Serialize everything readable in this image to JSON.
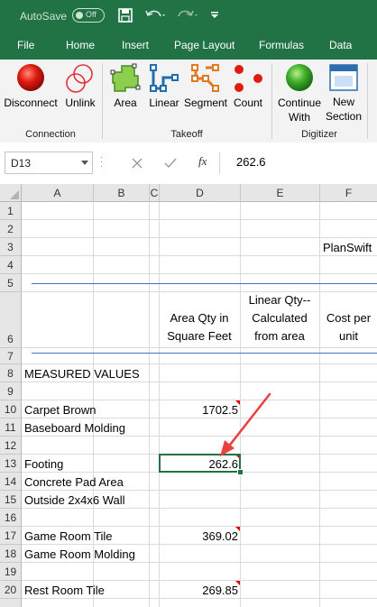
{
  "titlebar": {
    "autosave_label": "AutoSave",
    "autosave_state": "Off"
  },
  "tabs": [
    "File",
    "Home",
    "Insert",
    "Page Layout",
    "Formulas",
    "Data"
  ],
  "ribbon": {
    "connection": {
      "group": "Connection",
      "disconnect": "Disconnect",
      "unlink": "Unlink"
    },
    "takeoff": {
      "group": "Takeoff",
      "area": "Area",
      "linear": "Linear",
      "segment": "Segment",
      "count": "Count"
    },
    "digitizer": {
      "group": "Digitizer",
      "continue_line1": "Continue",
      "continue_line2": "With",
      "new_line1": "New",
      "new_line2": "Section"
    }
  },
  "formula_bar": {
    "name_box": "D13",
    "fx": "fx",
    "value": "262.6"
  },
  "columns": [
    "A",
    "B",
    "C",
    "D",
    "E",
    "F"
  ],
  "rows": [
    "1",
    "2",
    "3",
    "4",
    "5",
    "6",
    "7",
    "8",
    "9",
    "10",
    "11",
    "12",
    "13",
    "14",
    "15",
    "16",
    "17",
    "18",
    "19",
    "20"
  ],
  "cells": {
    "F3": "PlanSwift",
    "D6_line1": "Area Qty in",
    "D6_line2": "Square Feet",
    "E6_line1": "Linear Qty--",
    "E6_line2": "Calculated",
    "E6_line3": "from area",
    "F6_line1": "Cost per",
    "F6_line2": "unit",
    "A8": "MEASURED VALUES",
    "A10": "Carpet Brown",
    "D10": "1702.5",
    "A11": "Baseboard Molding",
    "A13": "Footing",
    "D13": "262.6",
    "A14": "Concrete Pad Area",
    "A15": "Outside 2x4x6 Wall",
    "A17": "Game Room Tile",
    "D17": "369.02",
    "A18": "Game Room Molding",
    "A20": "Rest Room Tile",
    "D20": "269.85"
  },
  "colors": {
    "excel_green": "#217346",
    "arrow_red": "#e8413f",
    "separator_blue": "#4472c4"
  }
}
